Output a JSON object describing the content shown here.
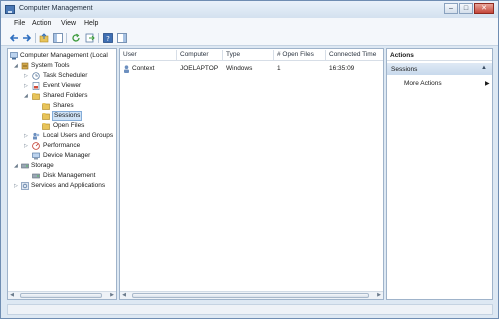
{
  "window": {
    "title": "Computer Management"
  },
  "menu": [
    "File",
    "Action",
    "View",
    "Help"
  ],
  "tree": [
    {
      "label": "Computer Management (Local"
    },
    {
      "label": "System Tools"
    },
    {
      "label": "Task Scheduler"
    },
    {
      "label": "Event Viewer"
    },
    {
      "label": "Shared Folders"
    },
    {
      "label": "Shares"
    },
    {
      "label": "Sessions"
    },
    {
      "label": "Open Files"
    },
    {
      "label": "Local Users and Groups"
    },
    {
      "label": "Performance"
    },
    {
      "label": "Device Manager"
    },
    {
      "label": "Storage"
    },
    {
      "label": "Disk Management"
    },
    {
      "label": "Services and Applications"
    }
  ],
  "list": {
    "columns": [
      "User",
      "Computer",
      "Type",
      "# Open Files",
      "Connected Time"
    ],
    "rows": [
      {
        "user": "Context",
        "computer": "JOELAPTOP",
        "type": "Windows",
        "open_files": "1",
        "connected_time": "16:35:09"
      }
    ]
  },
  "actions": {
    "header": "Actions",
    "section": "Sessions",
    "items": [
      "More Actions"
    ]
  },
  "colors": {
    "frame": "#dde8f3",
    "selection": "#cfe3f7",
    "accent": "#4a78b5"
  }
}
